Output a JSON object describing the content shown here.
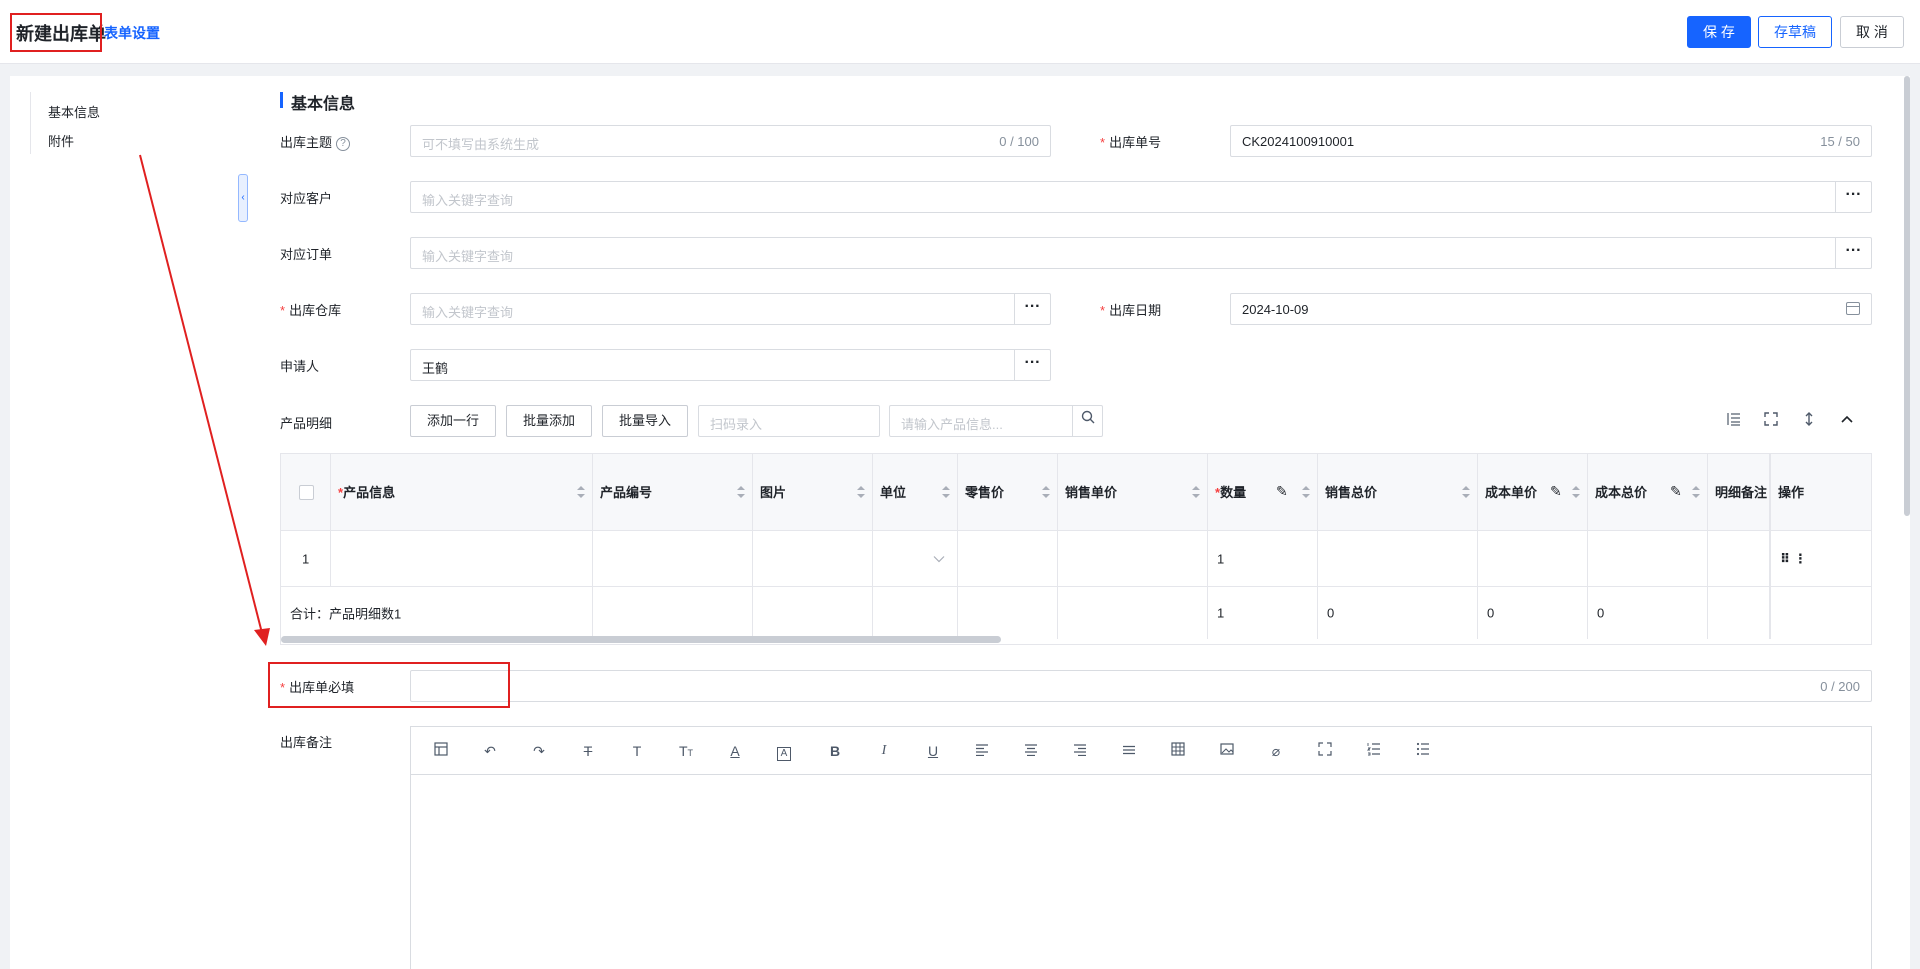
{
  "header": {
    "title": "新建出库单",
    "form_settings": "表单设置",
    "save": "保 存",
    "draft": "存草稿",
    "cancel": "取 消"
  },
  "nav": {
    "items": [
      "基本信息",
      "附件"
    ],
    "collapse_glyph": "‹"
  },
  "section": {
    "title": "基本信息"
  },
  "fields": {
    "subject": {
      "label": "出库主题",
      "placeholder": "可不填写由系统生成",
      "counter": "0 / 100",
      "help": "?"
    },
    "order_no": {
      "label": "出库单号",
      "value": "CK2024100910001",
      "counter": "15 / 50"
    },
    "customer": {
      "label": "对应客户",
      "placeholder": "输入关键字查询"
    },
    "order": {
      "label": "对应订单",
      "placeholder": "输入关键字查询"
    },
    "warehouse": {
      "label": "出库仓库",
      "placeholder": "输入关键字查询"
    },
    "date": {
      "label": "出库日期",
      "value": "2024-10-09"
    },
    "applicant": {
      "label": "申请人",
      "value": "王鹤"
    },
    "required_field": {
      "label": "出库单必填",
      "counter": "0 / 200"
    },
    "remark": {
      "label": "出库备注"
    }
  },
  "required_mark": "*",
  "dots": "···",
  "products": {
    "label": "产品明细",
    "add_row": "添加一行",
    "batch_add": "批量添加",
    "batch_import": "批量导入",
    "scan_placeholder": "扫码录入",
    "search_placeholder": "请输入产品信息..."
  },
  "table": {
    "columns": [
      "产品信息",
      "产品编号",
      "图片",
      "单位",
      "零售价",
      "销售单价",
      "数量",
      "销售总价",
      "成本单价",
      "成本总价",
      "明细备注",
      "操作"
    ],
    "required_columns": [
      "产品信息",
      "数量"
    ],
    "row": {
      "index": "1",
      "quantity": "1",
      "actions": "⠿ ⋮"
    },
    "summary": {
      "label": "合计：产品明细数1",
      "quantity": "1",
      "sales_total": "0",
      "cost_unit": "0",
      "cost_total": "0"
    }
  },
  "colors": {
    "primary": "#1664ff",
    "required": "#f53f3f",
    "annotation": "#e02020"
  },
  "icons": {
    "table_tools": [
      "row-height-icon",
      "fullscreen-icon",
      "expand-icon",
      "chevron-up-icon"
    ],
    "editor_tools": [
      "template-icon",
      "undo-icon",
      "redo-icon",
      "strikethrough-icon",
      "text-icon",
      "font-size-icon",
      "font-color-icon",
      "background-color-icon",
      "bold-icon",
      "italic-icon",
      "underline-icon",
      "align-left-icon",
      "align-center-icon",
      "align-right-icon",
      "justify-icon",
      "table-icon",
      "image-icon",
      "attachment-icon",
      "fullscreen-icon",
      "ordered-list-icon",
      "unordered-list-icon"
    ]
  }
}
